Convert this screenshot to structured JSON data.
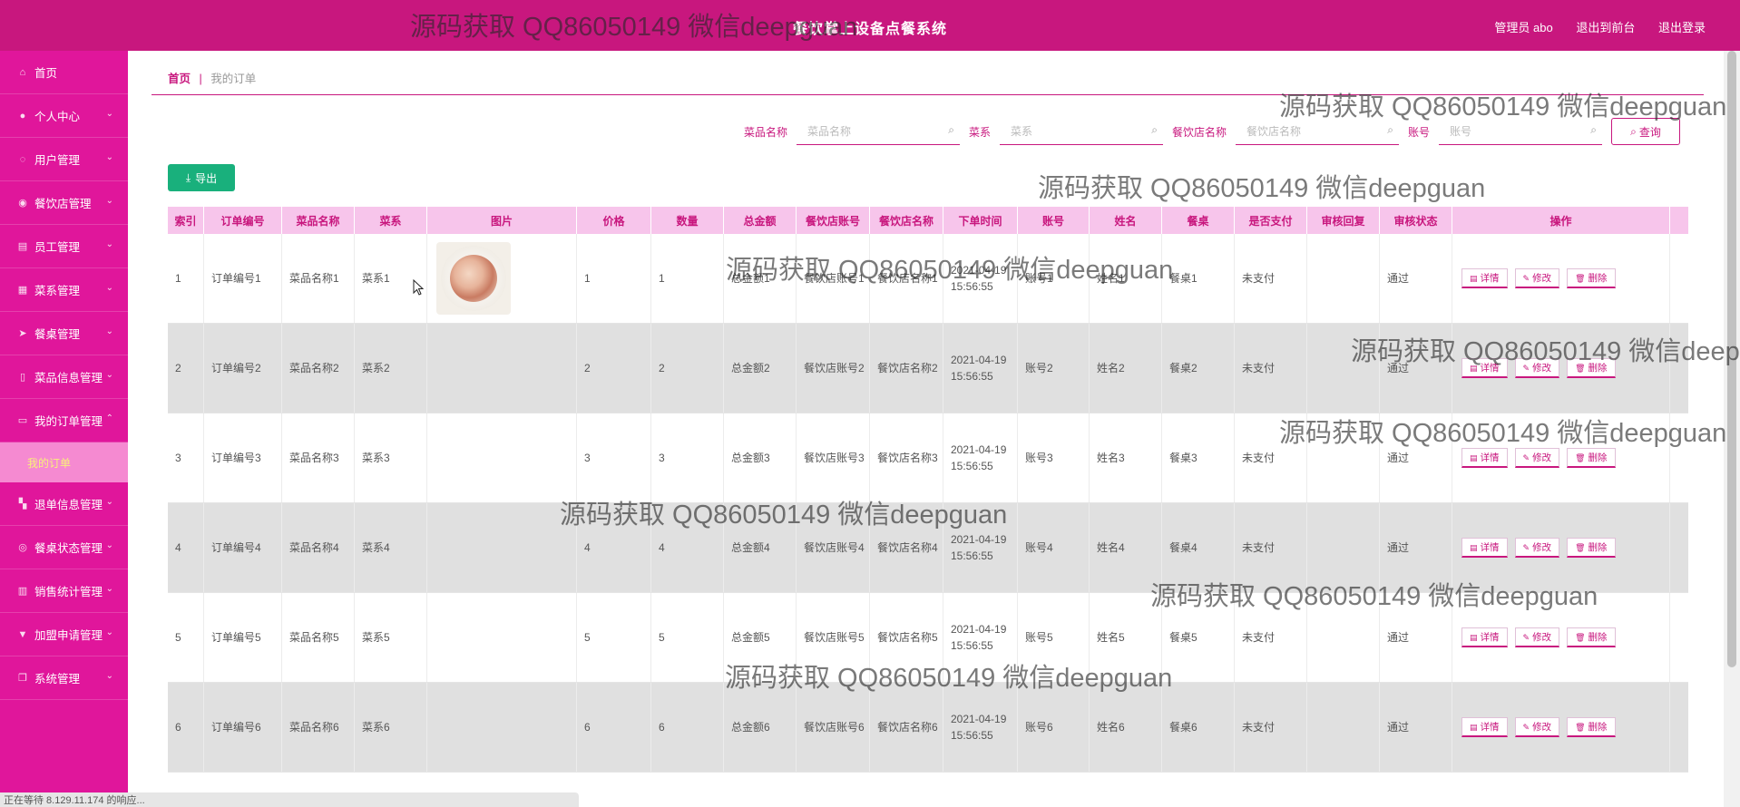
{
  "header": {
    "title": "餐饮掌上设备点餐系统",
    "admin": "管理员 abo",
    "front": "退出到前台",
    "logout": "退出登录"
  },
  "sidebar": {
    "items": [
      {
        "label": "首页",
        "icon": "home-icon",
        "glyph": "⌂",
        "chev": ""
      },
      {
        "label": "个人中心",
        "icon": "user-icon",
        "glyph": "●",
        "chev": "⌄"
      },
      {
        "label": "用户管理",
        "icon": "power-icon",
        "glyph": "◌",
        "chev": "⌄"
      },
      {
        "label": "餐饮店管理",
        "icon": "location-icon",
        "glyph": "◉",
        "chev": "⌄"
      },
      {
        "label": "员工管理",
        "icon": "document-icon",
        "glyph": "▤",
        "chev": "⌄"
      },
      {
        "label": "菜系管理",
        "icon": "grid-icon",
        "glyph": "▦",
        "chev": "⌄"
      },
      {
        "label": "餐桌管理",
        "icon": "send-icon",
        "glyph": "➤",
        "chev": "⌄"
      },
      {
        "label": "菜品信息管理",
        "icon": "phone-icon",
        "glyph": "▯",
        "chev": "⌄"
      },
      {
        "label": "我的订单管理",
        "icon": "monitor-icon",
        "glyph": "▭",
        "chev": "⌃"
      }
    ],
    "sub_active": "我的订单",
    "items2": [
      {
        "label": "退单信息管理",
        "icon": "apps-icon",
        "glyph": "▚",
        "chev": "⌄"
      },
      {
        "label": "餐桌状态管理",
        "icon": "compass-icon",
        "glyph": "◎",
        "chev": "⌄"
      },
      {
        "label": "销售统计管理",
        "icon": "bar-chart-icon",
        "glyph": "▥",
        "chev": "⌄"
      },
      {
        "label": "加盟申请管理",
        "icon": "cup-icon",
        "glyph": "▼",
        "chev": "⌄"
      },
      {
        "label": "系统管理",
        "icon": "copy-icon",
        "glyph": "❐",
        "chev": "⌄"
      }
    ]
  },
  "breadcrumb": {
    "home": "首页",
    "sep": "|",
    "current": "我的订单"
  },
  "search": {
    "dish_label": "菜品名称",
    "dish_placeholder": "菜品名称",
    "cuisine_label": "菜系",
    "cuisine_placeholder": "菜系",
    "store_label": "餐饮店名称",
    "store_placeholder": "餐饮店名称",
    "account_label": "账号",
    "account_placeholder": "账号",
    "query": "查询"
  },
  "export": "导出",
  "table": {
    "headers": [
      "索引",
      "订单编号",
      "菜品名称",
      "菜系",
      "图片",
      "价格",
      "数量",
      "总金额",
      "餐饮店账号",
      "餐饮店名称",
      "下单时间",
      "账号",
      "姓名",
      "餐桌",
      "是否支付",
      "审核回复",
      "审核状态",
      "操作"
    ],
    "actions": {
      "detail": "详情",
      "edit": "修改",
      "delete": "删除"
    },
    "rows": [
      {
        "idx": "1",
        "no": "订单编号1",
        "dish": "菜品名称1",
        "cuisine": "菜系1",
        "has_img": true,
        "price": "1",
        "qty": "1",
        "total": "总金额1",
        "acct": "餐饮店账号1",
        "store": "餐饮店名称1",
        "time": "2021-04-19 15:56:55",
        "user": "账号1",
        "name": "姓名1",
        "table": "餐桌1",
        "paid": "未支付",
        "reply": "",
        "status": "通过"
      },
      {
        "idx": "2",
        "no": "订单编号2",
        "dish": "菜品名称2",
        "cuisine": "菜系2",
        "has_img": false,
        "price": "2",
        "qty": "2",
        "total": "总金额2",
        "acct": "餐饮店账号2",
        "store": "餐饮店名称2",
        "time": "2021-04-19 15:56:55",
        "user": "账号2",
        "name": "姓名2",
        "table": "餐桌2",
        "paid": "未支付",
        "reply": "",
        "status": "通过"
      },
      {
        "idx": "3",
        "no": "订单编号3",
        "dish": "菜品名称3",
        "cuisine": "菜系3",
        "has_img": false,
        "price": "3",
        "qty": "3",
        "total": "总金额3",
        "acct": "餐饮店账号3",
        "store": "餐饮店名称3",
        "time": "2021-04-19 15:56:55",
        "user": "账号3",
        "name": "姓名3",
        "table": "餐桌3",
        "paid": "未支付",
        "reply": "",
        "status": "通过"
      },
      {
        "idx": "4",
        "no": "订单编号4",
        "dish": "菜品名称4",
        "cuisine": "菜系4",
        "has_img": false,
        "price": "4",
        "qty": "4",
        "total": "总金额4",
        "acct": "餐饮店账号4",
        "store": "餐饮店名称4",
        "time": "2021-04-19 15:56:55",
        "user": "账号4",
        "name": "姓名4",
        "table": "餐桌4",
        "paid": "未支付",
        "reply": "",
        "status": "通过"
      },
      {
        "idx": "5",
        "no": "订单编号5",
        "dish": "菜品名称5",
        "cuisine": "菜系5",
        "has_img": false,
        "price": "5",
        "qty": "5",
        "total": "总金额5",
        "acct": "餐饮店账号5",
        "store": "餐饮店名称5",
        "time": "2021-04-19 15:56:55",
        "user": "账号5",
        "name": "姓名5",
        "table": "餐桌5",
        "paid": "未支付",
        "reply": "",
        "status": "通过"
      },
      {
        "idx": "6",
        "no": "订单编号6",
        "dish": "菜品名称6",
        "cuisine": "菜系6",
        "has_img": false,
        "price": "6",
        "qty": "6",
        "total": "总金额6",
        "acct": "餐饮店账号6",
        "store": "餐饮店名称6",
        "time": "2021-04-19 15:56:55",
        "user": "账号6",
        "name": "姓名6",
        "table": "餐桌6",
        "paid": "未支付",
        "reply": "",
        "status": "通过"
      }
    ]
  },
  "watermark": "源码获取 QQ86050149 微信deepguan",
  "status_bar": "正在等待 8.129.11.174 的响应..."
}
